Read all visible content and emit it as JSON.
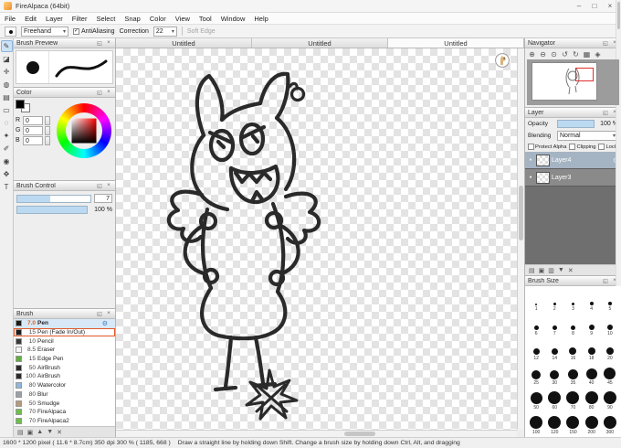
{
  "chrome": {
    "float_glyph": "◱",
    "close_glyph": "×",
    "min_glyph": "–",
    "max_glyph": "□",
    "gear_glyph": "⚙",
    "check_glyph": "✓",
    "dropdown_arrow": "▾",
    "visibility_dot": "●"
  },
  "window": {
    "title": "FireAlpaca (64bit)"
  },
  "menubar": {
    "items": [
      "File",
      "Edit",
      "Layer",
      "Filter",
      "Select",
      "Snap",
      "Color",
      "View",
      "Tool",
      "Window",
      "Help"
    ]
  },
  "toolbar": {
    "stroke_mode": "Freehand",
    "antialiasing_label": "AntiAliasing",
    "correction_label": "Correction",
    "correction_value": "22",
    "soft_edge_label": "Soft Edge"
  },
  "tools": [
    {
      "name": "brush-tool",
      "glyph": "✎"
    },
    {
      "name": "eraser-tool",
      "glyph": "◪"
    },
    {
      "name": "move-tool",
      "glyph": "✛"
    },
    {
      "name": "fill-tool",
      "glyph": "◍"
    },
    {
      "name": "gradient-tool",
      "glyph": "▤"
    },
    {
      "name": "rect-select-tool",
      "glyph": "▭"
    },
    {
      "name": "lasso-tool",
      "glyph": "◌"
    },
    {
      "name": "magic-wand-tool",
      "glyph": "✦"
    },
    {
      "name": "select-pen-tool",
      "glyph": "✐"
    },
    {
      "name": "eyedropper-tool",
      "glyph": "◉"
    },
    {
      "name": "hand-tool",
      "glyph": "✥"
    },
    {
      "name": "text-tool",
      "glyph": "T"
    }
  ],
  "canvas": {
    "tabs": [
      "Untitled",
      "Untitled",
      "Untitled"
    ],
    "active_tab": 2
  },
  "panels": {
    "brush_preview": {
      "title": "Brush Preview"
    },
    "color": {
      "title": "Color",
      "channels": [
        {
          "label": "R",
          "value": "0"
        },
        {
          "label": "G",
          "value": "0"
        },
        {
          "label": "B",
          "value": "0"
        }
      ]
    },
    "brush_control": {
      "title": "Brush Control",
      "size_value": "7",
      "opacity_value": "100 %"
    },
    "brush": {
      "title": "Brush",
      "items": [
        {
          "size": "7.0",
          "name": "Pen",
          "swatch": "#1a1a1a",
          "selected": true
        },
        {
          "size": "15",
          "name": "Pen (Fade In/Out)",
          "swatch": "#1a1a1a",
          "outlined": true
        },
        {
          "size": "10",
          "name": "Pencil",
          "swatch": "#3a3a3a"
        },
        {
          "size": "8.5",
          "name": "Eraser",
          "swatch": "#f5f5f5"
        },
        {
          "size": "15",
          "name": "Edge Pen",
          "swatch": "#5fae3c"
        },
        {
          "size": "50",
          "name": "AirBrush",
          "swatch": "#2a2a2a"
        },
        {
          "size": "100",
          "name": "AirBrush",
          "swatch": "#2a2a2a"
        },
        {
          "size": "80",
          "name": "Watercolor",
          "swatch": "#8fb7d9"
        },
        {
          "size": "80",
          "name": "Blur",
          "swatch": "#9aa0a8"
        },
        {
          "size": "50",
          "name": "Smudge",
          "swatch": "#b59a7e"
        },
        {
          "size": "70",
          "name": "FireAlpaca",
          "swatch": "#6cc04a"
        },
        {
          "size": "70",
          "name": "FireAlpaca2",
          "swatch": "#6cc04a"
        }
      ],
      "footer_icons": [
        {
          "name": "add-brush",
          "glyph": "▤"
        },
        {
          "name": "brush-folder",
          "glyph": "▣"
        },
        {
          "name": "brush-move-up",
          "glyph": "▲"
        },
        {
          "name": "brush-move-down",
          "glyph": "▼"
        },
        {
          "name": "delete-brush",
          "glyph": "✕"
        }
      ]
    },
    "navigator": {
      "title": "Navigator",
      "icons": [
        {
          "name": "zoom-in",
          "glyph": "⊕"
        },
        {
          "name": "zoom-out",
          "glyph": "⊖"
        },
        {
          "name": "zoom-reset",
          "glyph": "⊙"
        },
        {
          "name": "rotate-left",
          "glyph": "↺"
        },
        {
          "name": "rotate-right",
          "glyph": "↻"
        },
        {
          "name": "reset-view",
          "glyph": "▦"
        },
        {
          "name": "fit-window",
          "glyph": "◈"
        }
      ]
    },
    "layer": {
      "title": "Layer",
      "opacity_label": "Opacity",
      "opacity_value": "100 %",
      "blending_label": "Blending",
      "blending_value": "Normal",
      "checkboxes": [
        "Protect Alpha",
        "Clipping",
        "Lock"
      ],
      "layers": [
        {
          "name": "Layer4",
          "selected": true
        },
        {
          "name": "Layer3",
          "selected": false
        }
      ],
      "footer_icons": [
        {
          "name": "add-layer",
          "glyph": "▤"
        },
        {
          "name": "add-folder",
          "glyph": "▣"
        },
        {
          "name": "duplicate-layer",
          "glyph": "▥"
        },
        {
          "name": "merge-down",
          "glyph": "▼"
        },
        {
          "name": "delete-layer",
          "glyph": "✕"
        }
      ]
    },
    "brush_size": {
      "title": "Brush Size",
      "sizes": [
        1,
        2,
        3,
        4,
        5,
        6,
        7,
        8,
        9,
        10,
        12,
        14,
        16,
        18,
        20,
        25,
        30,
        35,
        40,
        45,
        50,
        60,
        70,
        80,
        90,
        100,
        120,
        150,
        200,
        300
      ]
    }
  },
  "statusbar": {
    "doc_info": "1600 * 1200 pixel  ( 11.6 * 8.7cm)   350 dpi   300 %   ( 1185, 668 )",
    "hint": "Draw a straight line by holding down Shift. Change a brush size by holding down Ctrl, Alt, and dragging"
  }
}
